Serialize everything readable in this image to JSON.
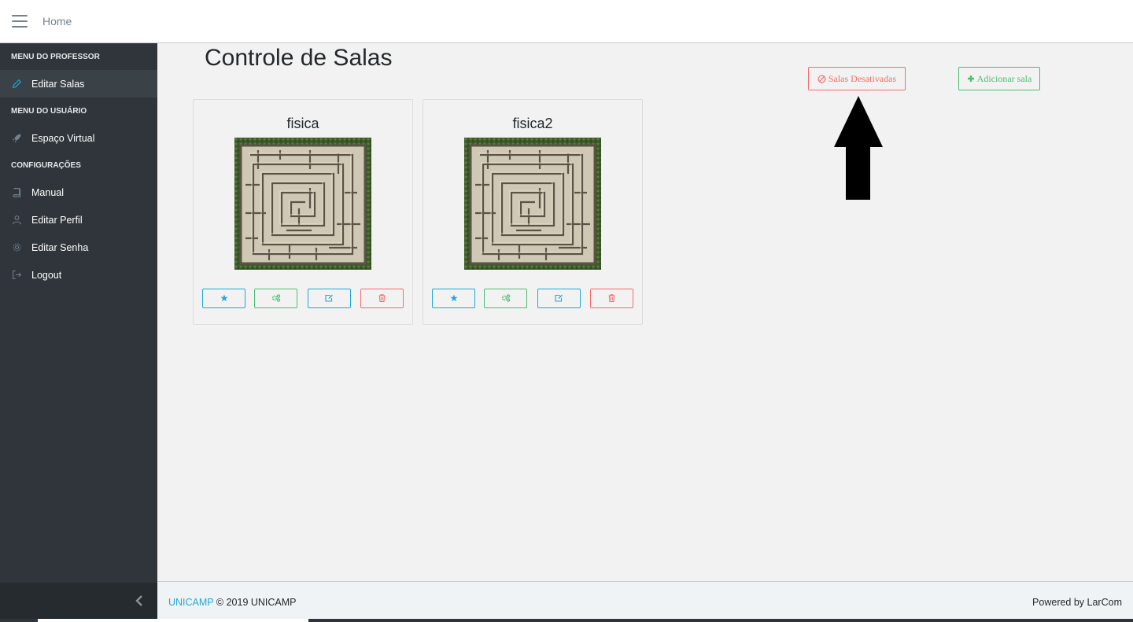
{
  "header": {
    "home_label": "Home"
  },
  "sidebar": {
    "sections": [
      {
        "title": "MENU DO PROFESSOR",
        "items": [
          {
            "label": "Editar Salas",
            "icon": "pencil-icon",
            "active": true
          }
        ]
      },
      {
        "title": "MENU DO USUÁRIO",
        "items": [
          {
            "label": "Espaço Virtual",
            "icon": "rocket-icon"
          }
        ]
      },
      {
        "title": "CONFIGURAÇÕES",
        "items": [
          {
            "label": "Manual",
            "icon": "book-icon"
          },
          {
            "label": "Editar Perfil",
            "icon": "user-icon"
          },
          {
            "label": "Editar Senha",
            "icon": "gear-icon"
          },
          {
            "label": "Logout",
            "icon": "logout-icon"
          }
        ]
      }
    ]
  },
  "main": {
    "title": "Controle de Salas",
    "deactivated_button": "Salas Desativadas",
    "add_button": "Adicionar sala",
    "cards": [
      {
        "title": "fisica",
        "image": "maze-image"
      },
      {
        "title": "fisica2",
        "image": "maze-image"
      }
    ]
  },
  "footer": {
    "brand_link": "UNICAMP",
    "copyright": "© 2019 UNICAMP",
    "powered_by": "Powered by LarCom"
  },
  "colors": {
    "sidebar_bg": "#2f353a",
    "primary": "#20a8d8",
    "success": "#4dbd74",
    "danger": "#f86c6b",
    "background": "#f2f2f2"
  }
}
